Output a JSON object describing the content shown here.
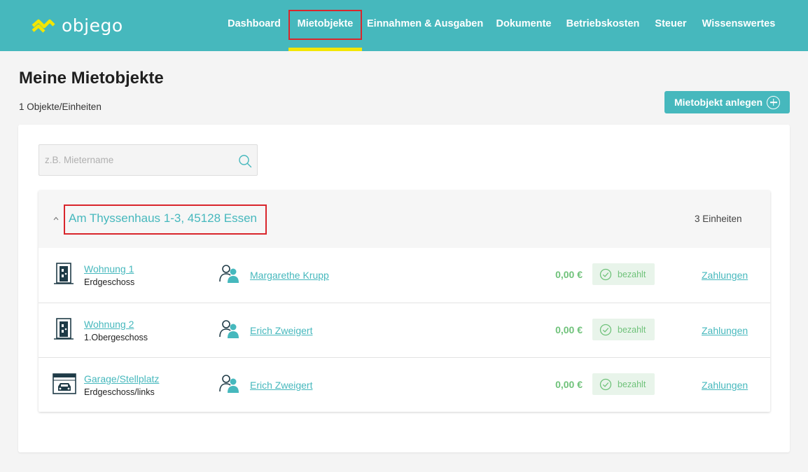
{
  "header": {
    "logo_text": "objego",
    "nav": [
      {
        "label": "Dashboard"
      },
      {
        "label": "Mietobjekte"
      },
      {
        "label": "Einnahmen & Ausgaben"
      },
      {
        "label": "Dokumente"
      },
      {
        "label": "Betriebskosten"
      },
      {
        "label": "Steuer"
      },
      {
        "label": "Wissenswertes"
      }
    ],
    "active_nav": "Mietobjekte"
  },
  "page": {
    "title": "Meine Mietobjekte",
    "subtitle": "1 Objekte/Einheiten",
    "add_button_label": "Mietobjekt anlegen"
  },
  "search": {
    "placeholder": "z.B. Mietername",
    "value": ""
  },
  "property": {
    "address": "Am Thyssenhaus 1-3, 45128 Essen",
    "unit_count": "3 Einheiten",
    "units": [
      {
        "icon": "apartment-door-icon",
        "name": "Wohnung 1",
        "floor": "Erdgeschoss",
        "tenant": "Margarethe Krupp",
        "amount": "0,00 €",
        "status": "bezahlt",
        "payments_link": "Zahlungen"
      },
      {
        "icon": "apartment-door-icon",
        "name": "Wohnung 2",
        "floor": "1.Obergeschoss",
        "tenant": "Erich Zweigert",
        "amount": "0,00 €",
        "status": "bezahlt",
        "payments_link": "Zahlungen"
      },
      {
        "icon": "garage-icon",
        "name": "Garage/Stellplatz",
        "floor": "Erdgeschoss/links",
        "tenant": "Erich Zweigert",
        "amount": "0,00 €",
        "status": "bezahlt",
        "payments_link": "Zahlungen"
      }
    ]
  },
  "colors": {
    "brand_teal": "#46b8bd",
    "accent_yellow": "#f3e600",
    "paid_green": "#6fc27a",
    "highlight_red": "#d9262c"
  }
}
